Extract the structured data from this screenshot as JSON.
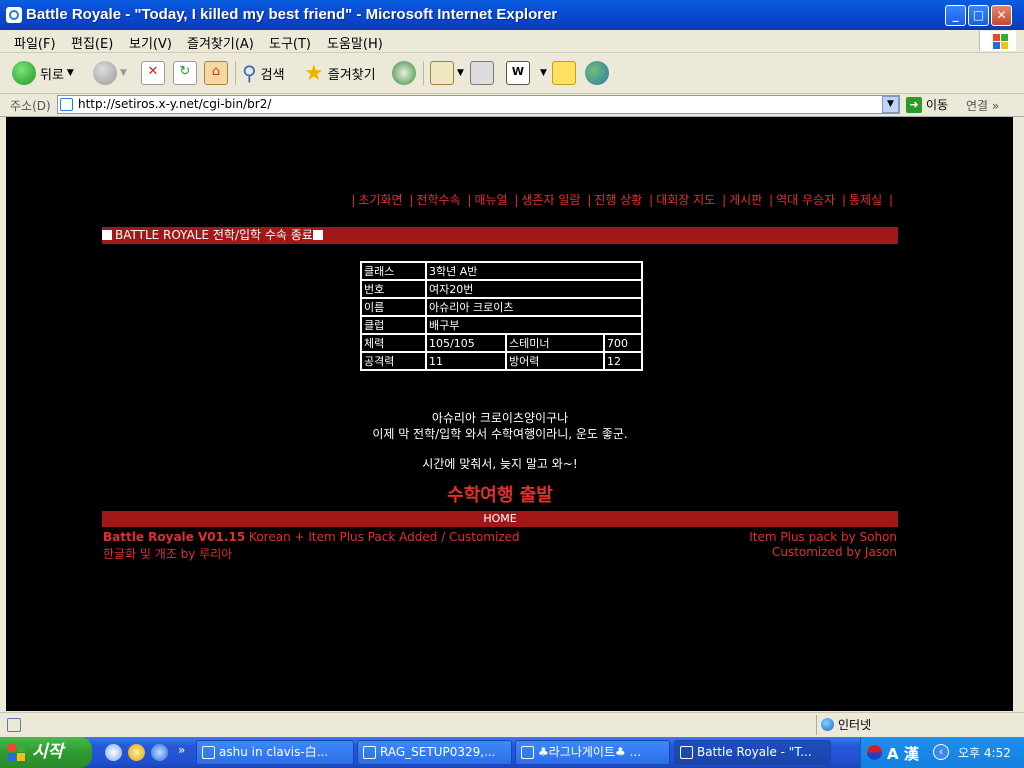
{
  "window": {
    "title": "Battle Royale - \"Today, I killed my best friend\" - Microsoft Internet Explorer"
  },
  "menu": [
    "파일(F)",
    "편집(E)",
    "보기(V)",
    "즐겨찾기(A)",
    "도구(T)",
    "도움말(H)"
  ],
  "toolbar": {
    "back": "뒤로",
    "search": "검색",
    "favorites": "즐겨찾기"
  },
  "address": {
    "label": "주소(D)",
    "url": "http://setiros.x-y.net/cgi-bin/br2/",
    "go": "이동",
    "links": "연결"
  },
  "page": {
    "nav": [
      "초기화면",
      "전학수속",
      "매뉴얼",
      "생존자 일람",
      "진행 상황",
      "대회장 지도",
      "게시판",
      "역대 우승자",
      "통제실"
    ],
    "section_title": "BATTLE ROYALE 전학/입학 수속 종료",
    "info": {
      "class_label": "클래스",
      "class_value": "3학년 A반",
      "number_label": "번호",
      "number_value": "여자20번",
      "name_label": "이름",
      "name_value": "아슈리아 크로이츠",
      "club_label": "클럽",
      "club_value": "배구부",
      "hp_label": "체력",
      "hp_value": "105/105",
      "stamina_label": "스테미너",
      "stamina_value": "700",
      "attack_label": "공격력",
      "attack_value": "11",
      "defense_label": "방어력",
      "defense_value": "12"
    },
    "message_line1": "아슈리아 크로이츠양이구나",
    "message_line2": "이제 막 전학/입학 와서 수학여행이라니, 운도 좋군.",
    "message_line3": "시간에 맞춰서, 늦지 말고 와~!",
    "depart": "수학여행 출발",
    "home": "HOME",
    "footer_version": "Battle Royale V01.15",
    "footer_desc": " Korean + Item Plus Pack Added / Customized",
    "footer_korean": "한글화 및 개조 by 루리아",
    "footer_credit1": "Item Plus pack by Sohon",
    "footer_credit2": "Customized by Jason"
  },
  "status": {
    "zone": "인터넷"
  },
  "taskbar": {
    "start": "시작",
    "tasks": [
      "ashu in clavis-白...",
      "RAG_SETUP0329,...",
      "♣라그나게이트♣ ...",
      "Battle Royale - \"T..."
    ],
    "ime": "A 漢",
    "clock": "오후 4:52"
  },
  "colors": {
    "accent_red": "#a01818",
    "link_red": "#e03030",
    "xp_blue": "#0a4bd4"
  }
}
